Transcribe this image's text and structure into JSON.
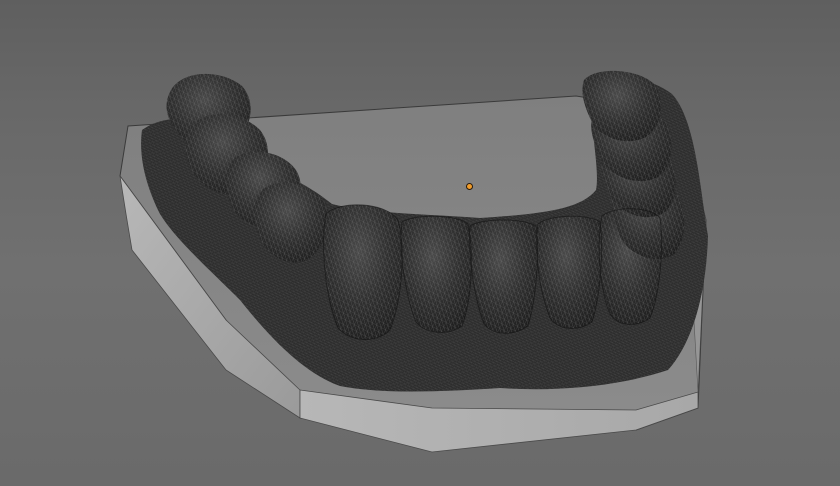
{
  "viewport": {
    "background_color": "#6f6f6f"
  },
  "scene": {
    "base_top_color": "#8b8b8b",
    "base_side_color": "#a2a2a2",
    "base_front_color": "#b1b1b1",
    "mesh_fill_color": "#2b2b2b",
    "wire_color": "#8a8a8a",
    "origin_point_color": "#f29d2a",
    "object": "dental-model"
  }
}
